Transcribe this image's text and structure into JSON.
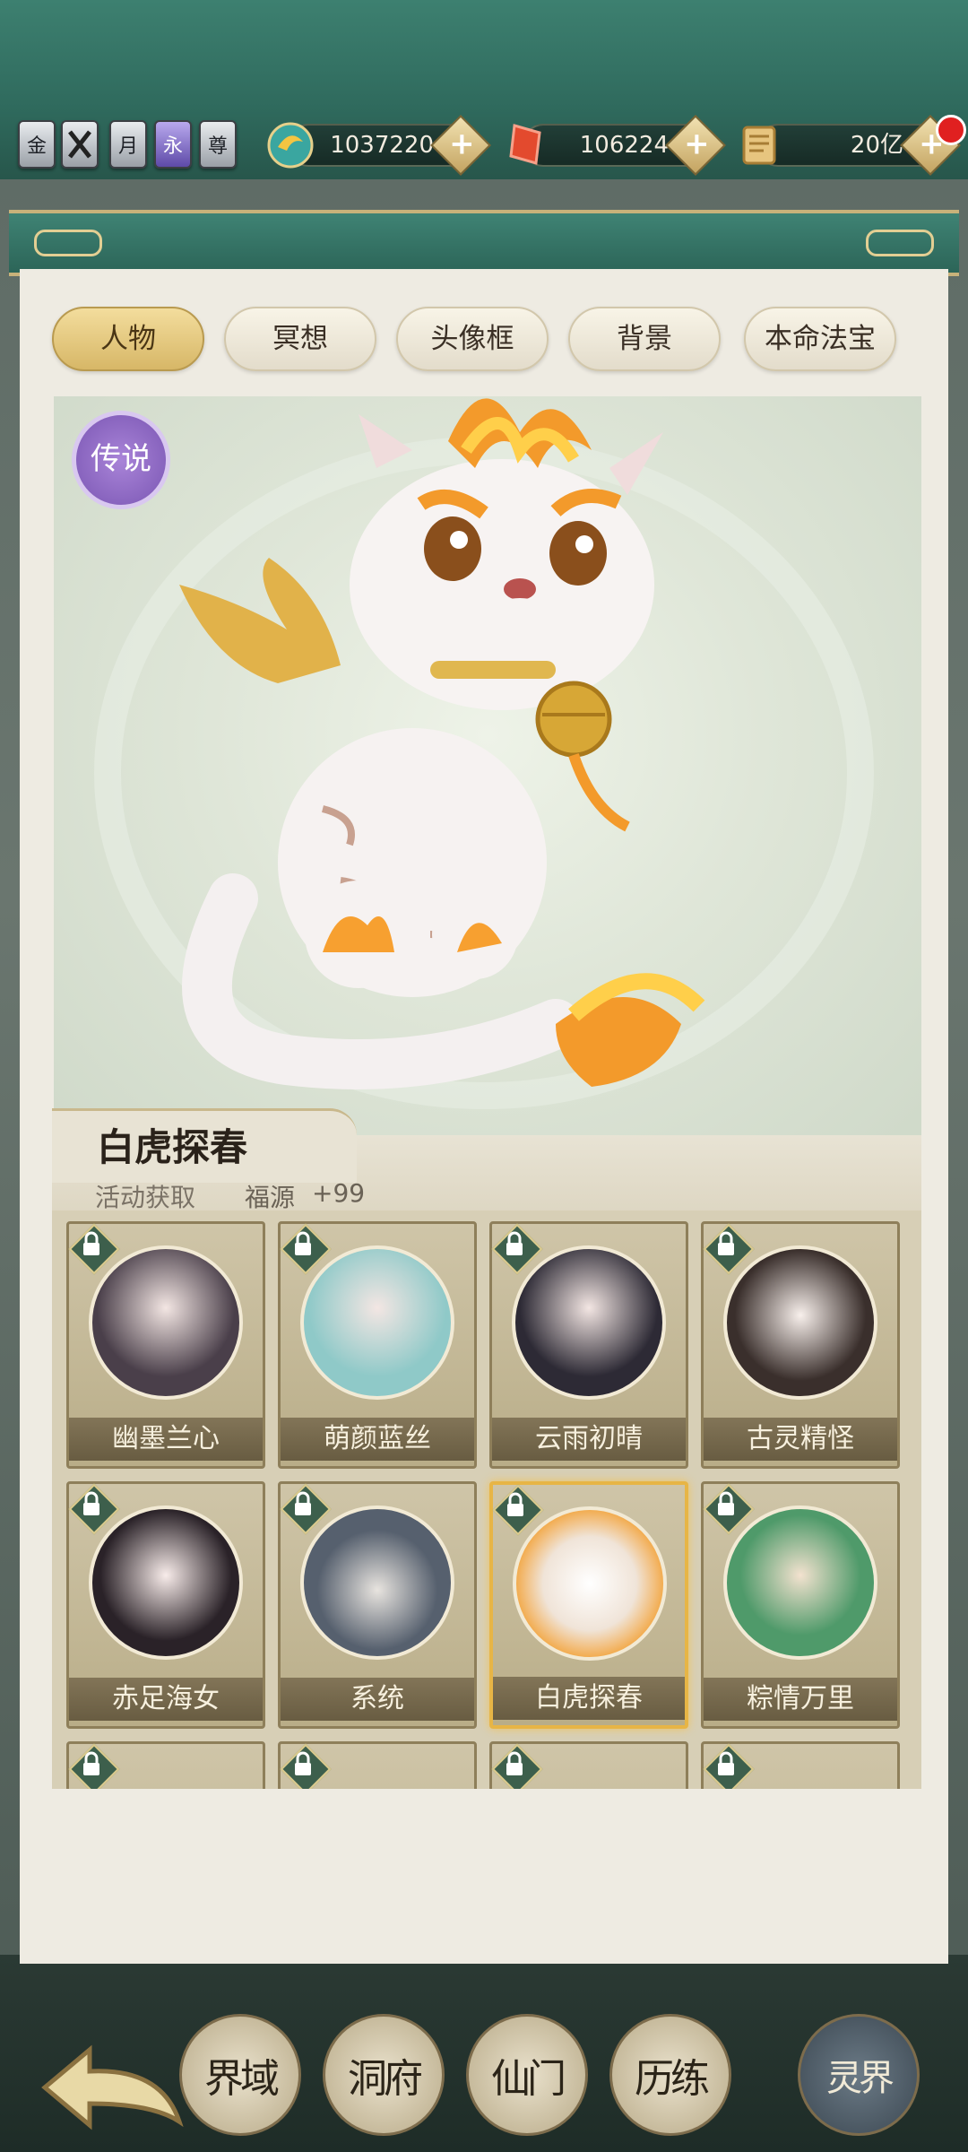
{
  "top_bar": {
    "badges": [
      "金",
      "",
      "月",
      "永",
      "尊"
    ],
    "resources": [
      {
        "icon": "spirit-stone-icon",
        "value": "1037220"
      },
      {
        "icon": "red-gem-icon",
        "value": "106224"
      },
      {
        "icon": "scroll-icon",
        "value": "20亿"
      }
    ],
    "plus_label": "+"
  },
  "tabs": [
    {
      "label": "人物",
      "active": true
    },
    {
      "label": "冥想",
      "active": false
    },
    {
      "label": "头像框",
      "active": false
    },
    {
      "label": "背景",
      "active": false
    },
    {
      "label": "本命法宝",
      "active": false
    }
  ],
  "preview": {
    "rarity": "传说",
    "name": "白虎探春",
    "source": "活动获取",
    "bonus_label": "福源",
    "bonus_value": "+99"
  },
  "cards": [
    {
      "name": "幽墨兰心",
      "locked": true,
      "selected": false,
      "tone": "#4a3f4a"
    },
    {
      "name": "萌颜蓝丝",
      "locked": true,
      "selected": false,
      "tone": "#8fc9c8"
    },
    {
      "name": "云雨初晴",
      "locked": true,
      "selected": false,
      "tone": "#2d2a35"
    },
    {
      "name": "古灵精怪",
      "locked": true,
      "selected": false,
      "tone": "#3a2f2c"
    },
    {
      "name": "赤足海女",
      "locked": true,
      "selected": false,
      "tone": "#2a2228"
    },
    {
      "name": "系统",
      "locked": true,
      "selected": false,
      "tone": "#56606e"
    },
    {
      "name": "白虎探春",
      "locked": true,
      "selected": true,
      "tone": "#f0e4d8"
    },
    {
      "name": "粽情万里",
      "locked": true,
      "selected": false,
      "tone": "#4f9a6a"
    }
  ],
  "bottom_nav": {
    "items": [
      "界域",
      "洞府",
      "仙门",
      "历练",
      "灵界"
    ]
  }
}
